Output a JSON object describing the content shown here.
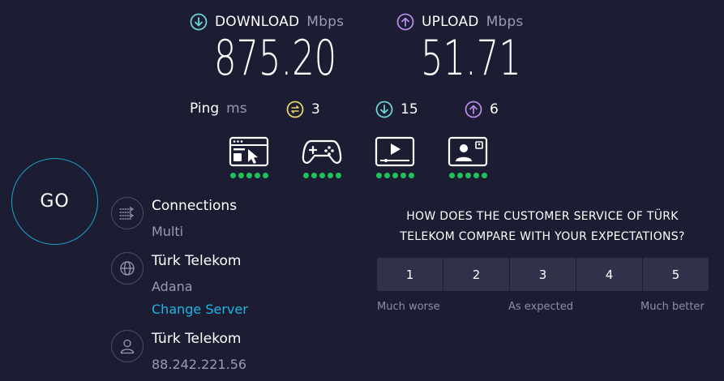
{
  "download": {
    "label": "DOWNLOAD",
    "unit": "Mbps",
    "value": "875.20",
    "icon": "download-arrow-icon",
    "color": "#6ad4d6"
  },
  "upload": {
    "label": "UPLOAD",
    "unit": "Mbps",
    "value": "51.71",
    "icon": "upload-arrow-icon",
    "color": "#b58be6"
  },
  "ping": {
    "label": "Ping",
    "unit": "ms",
    "idle": "3",
    "download": "15",
    "upload": "6",
    "idle_color": "#e8d26a"
  },
  "activities": [
    {
      "name": "web-browsing",
      "icon": "browser-icon",
      "rating": 5
    },
    {
      "name": "gaming",
      "icon": "gamepad-icon",
      "rating": 5
    },
    {
      "name": "streaming",
      "icon": "video-player-icon",
      "rating": 5
    },
    {
      "name": "video-calls",
      "icon": "video-call-icon",
      "rating": 5
    }
  ],
  "go_label": "GO",
  "connections": {
    "title": "Connections",
    "value": "Multi",
    "icon": "connections-arrows-icon"
  },
  "server": {
    "title": "Türk Telekom",
    "location": "Adana",
    "change_label": "Change Server",
    "icon": "globe-icon"
  },
  "provider": {
    "title": "Türk Telekom",
    "ip": "88.242.221.56",
    "icon": "user-icon"
  },
  "survey": {
    "question_line1": "HOW DOES THE CUSTOMER SERVICE OF TÜRK",
    "question_line2": "TELEKOM COMPARE WITH YOUR EXPECTATIONS?",
    "options": [
      "1",
      "2",
      "3",
      "4",
      "5"
    ],
    "scale_low": "Much worse",
    "scale_mid": "As expected",
    "scale_high": "Much better"
  },
  "colors": {
    "background": "#1c1d33",
    "accent_link": "#1cb5e8",
    "go_ring": "#1aa6c8",
    "rating_dot": "#1fc25b"
  }
}
